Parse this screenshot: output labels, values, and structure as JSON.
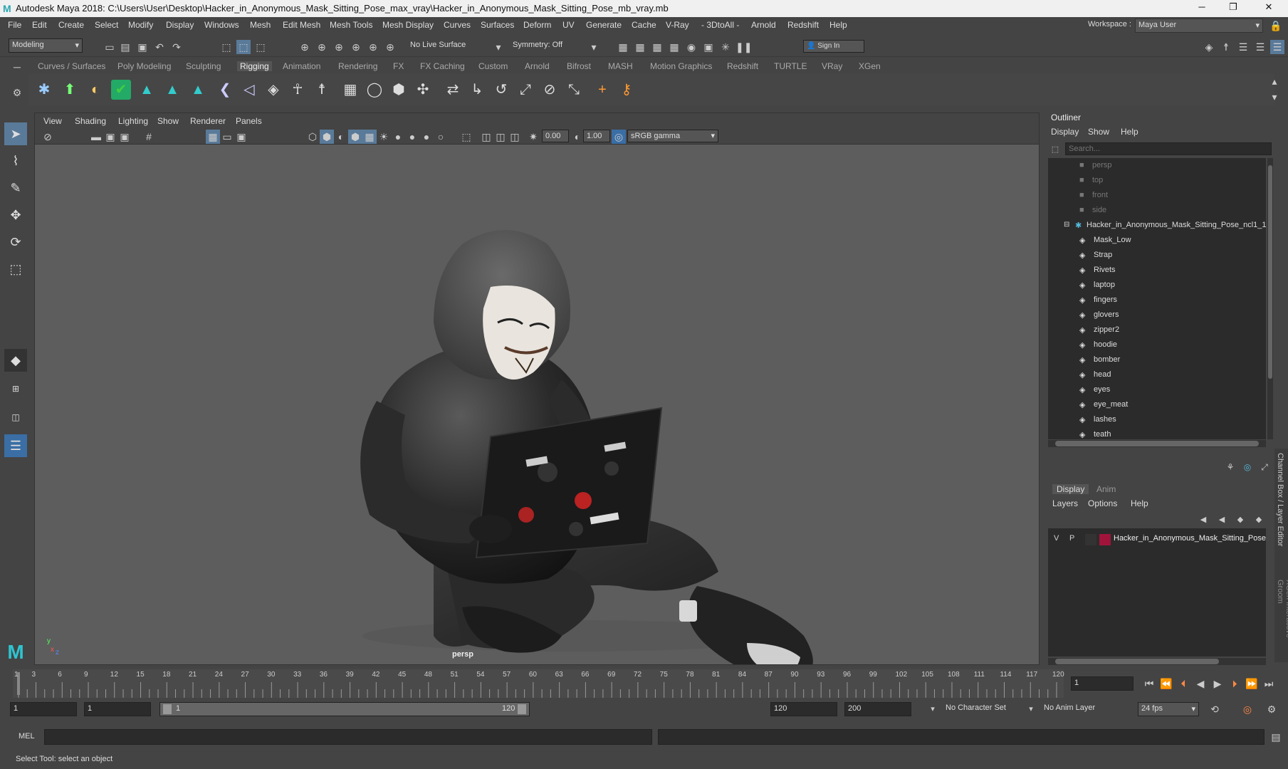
{
  "window": {
    "title": "Autodesk Maya 2018: C:\\Users\\User\\Desktop\\Hacker_in_Anonymous_Mask_Sitting_Pose_max_vray\\Hacker_in_Anonymous_Mask_Sitting_Pose_mb_vray.mb",
    "minimize": "─",
    "maximize": "❐",
    "close": "✕"
  },
  "menubar": {
    "items": [
      "File",
      "Edit",
      "Create",
      "Select",
      "Modify",
      "Display",
      "Windows",
      "Mesh",
      "Edit Mesh",
      "Mesh Tools",
      "Mesh Display",
      "Curves",
      "Surfaces",
      "Deform",
      "UV",
      "Generate",
      "Cache",
      "V-Ray",
      "- 3DtoAll -",
      "Arnold",
      "Redshift",
      "Help"
    ],
    "workspace_label": "Workspace :",
    "workspace_value": "Maya User"
  },
  "statusline": {
    "mode": "Modeling",
    "live_surface": "No Live Surface",
    "symmetry": "Symmetry: Off",
    "sign_in": "Sign In"
  },
  "shelf": {
    "tabs": [
      "Curves / Surfaces",
      "Poly Modeling",
      "Sculpting",
      "Rigging",
      "Animation",
      "Rendering",
      "FX",
      "FX Caching",
      "Custom",
      "Arnold",
      "Bifrost",
      "MASH",
      "Motion Graphics",
      "Redshift",
      "TURTLE",
      "VRay",
      "XGen"
    ],
    "active_tab": "Rigging"
  },
  "viewport": {
    "menu": [
      "View",
      "Shading",
      "Lighting",
      "Show",
      "Renderer",
      "Panels"
    ],
    "exposure": "0.00",
    "gamma": "1.00",
    "colorspace": "sRGB gamma",
    "camera_label": "persp",
    "axis_y": "y",
    "axis_x": "x",
    "axis_z": "z"
  },
  "outliner": {
    "title": "Outliner",
    "menu": [
      "Display",
      "Show",
      "Help"
    ],
    "search_placeholder": "Search...",
    "cameras": [
      "persp",
      "top",
      "front",
      "side"
    ],
    "group": "Hacker_in_Anonymous_Mask_Sitting_Pose_ncl1_1",
    "children": [
      "Mask_Low",
      "Strap",
      "Rivets",
      "laptop",
      "fingers",
      "glovers",
      "zipper2",
      "hoodie",
      "bomber",
      "head",
      "eyes",
      "eye_meat",
      "lashes",
      "teath"
    ]
  },
  "layer_editor": {
    "tabs": [
      "Display",
      "Anim"
    ],
    "menu": [
      "Layers",
      "Options",
      "Help"
    ],
    "layer_v": "V",
    "layer_p": "P",
    "layer_name": "Hacker_in_Anonymous_Mask_Sitting_Pose",
    "layer_color": "#a0143c",
    "side_tab_1": "Channel Box / Layer Editor",
    "side_tab_2": "XGen Interactive Groom"
  },
  "timeline": {
    "ticks": [
      "1",
      "3",
      "6",
      "9",
      "12",
      "15",
      "18",
      "21",
      "24",
      "27",
      "30",
      "33",
      "36",
      "39",
      "42",
      "45",
      "48",
      "51",
      "54",
      "57",
      "60",
      "63",
      "66",
      "69",
      "72",
      "75",
      "78",
      "81",
      "84",
      "87",
      "90",
      "93",
      "96",
      "99",
      "102",
      "105",
      "108",
      "111",
      "114",
      "117",
      "120"
    ],
    "current_frame": "1"
  },
  "range": {
    "start": "1",
    "playback_start": "1",
    "slider_start": "1",
    "slider_end": "120",
    "playback_end": "120",
    "end": "200",
    "character_set": "No Character Set",
    "anim_layer": "No Anim Layer",
    "fps": "24 fps"
  },
  "mel": {
    "label": "MEL"
  },
  "help_line": "Select Tool: select an object"
}
